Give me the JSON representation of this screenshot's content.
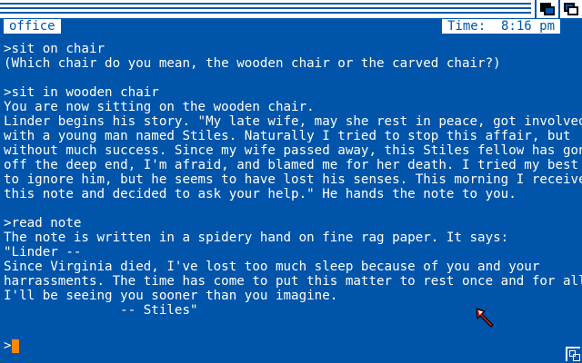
{
  "status_bar": {
    "room": "office",
    "time": "Time:  8:16 pm"
  },
  "transcript": [
    ">sit on chair",
    "(Which chair do you mean, the wooden chair or the carved chair?)",
    "",
    ">sit in wooden chair",
    "You are now sitting on the wooden chair.",
    "Linder begins his story. \"My late wife, may she rest in peace, got involved",
    "with a young man named Stiles. Naturally I tried to stop this affair, but",
    "without much success. Since my wife passed away, this Stiles fellow has gone",
    "off the deep end, I'm afraid, and blamed me for her death. I tried my best",
    "to ignore him, but he seems to have lost his senses. This morning I received",
    "this note and decided to ask your help.\" He hands the note to you.",
    "",
    ">read note",
    "The note is written in a spidery hand on fine rag paper. It says:",
    "\"Linder --",
    "Since Virginia died, I've lost too much sleep because of you and your",
    "harrassments. The time has come to put this matter to rest once and for all.",
    "I'll be seeing you sooner than you imagine.",
    "               -- Stiles\""
  ],
  "prompt": {
    "symbol": ">",
    "value": ""
  },
  "colors": {
    "background": "#0055aa",
    "text": "#ffffff",
    "cursor": "#ff8800",
    "pointer": "#cc2222"
  },
  "icons": {
    "depth_back": "depth-back-gadget-icon",
    "depth_front": "depth-front-gadget-icon",
    "pointer": "mouse-pointer-icon",
    "resize": "resize-gadget-icon"
  }
}
